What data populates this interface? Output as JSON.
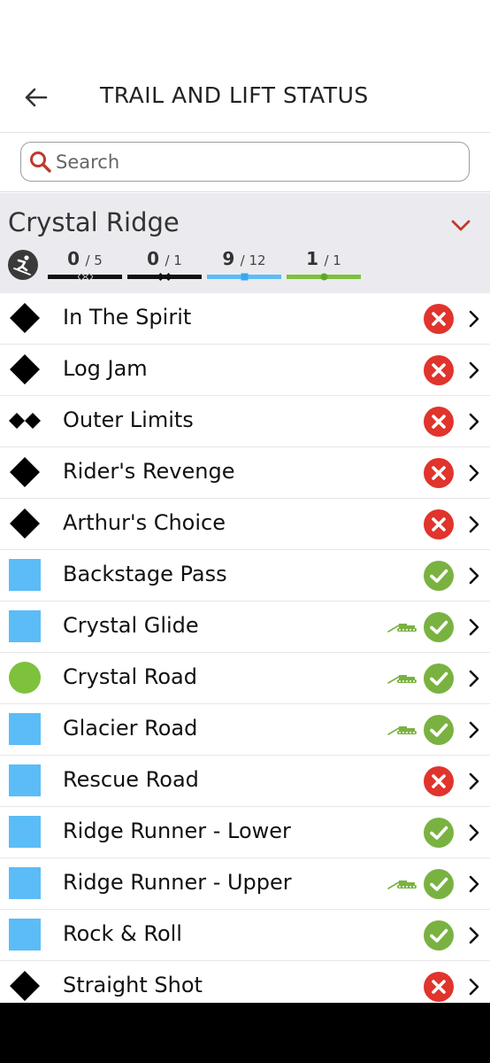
{
  "header": {
    "title": "TRAIL AND LIFT STATUS",
    "back_icon": "arrow-left-icon"
  },
  "search": {
    "placeholder": "Search",
    "icon": "search-icon"
  },
  "colors": {
    "accent_red": "#c0392b",
    "open_green": "#7ab241",
    "closed_red": "#e0342c",
    "blue_square": "#5bbcf7",
    "green_circle": "#7dc13c",
    "black_diamond": "#000000"
  },
  "area": {
    "name": "Crystal Ridge",
    "stats": [
      {
        "key": "double_black",
        "open": "0",
        "total": "/ 5",
        "color": "#111111",
        "marker": "double-diamond"
      },
      {
        "key": "black",
        "open": "0",
        "total": "/ 1",
        "color": "#111111",
        "marker": "diamond"
      },
      {
        "key": "blue",
        "open": "9",
        "total": "/ 12",
        "color": "#5bbcf7",
        "marker": "square"
      },
      {
        "key": "green",
        "open": "1",
        "total": "/ 1",
        "color": "#7dc13c",
        "marker": "circle"
      }
    ]
  },
  "trails": [
    {
      "name": "In The Spirit",
      "difficulty": "black-diamond",
      "status": "closed",
      "groomed": false
    },
    {
      "name": "Log Jam",
      "difficulty": "black-diamond",
      "status": "closed",
      "groomed": false
    },
    {
      "name": "Outer Limits",
      "difficulty": "double-black-diamond",
      "status": "closed",
      "groomed": false
    },
    {
      "name": "Rider's Revenge",
      "difficulty": "black-diamond",
      "status": "closed",
      "groomed": false
    },
    {
      "name": "Arthur's Choice",
      "difficulty": "black-diamond",
      "status": "closed",
      "groomed": false
    },
    {
      "name": "Backstage Pass",
      "difficulty": "blue-square",
      "status": "open",
      "groomed": false
    },
    {
      "name": "Crystal Glide",
      "difficulty": "blue-square",
      "status": "open",
      "groomed": true
    },
    {
      "name": "Crystal Road",
      "difficulty": "green-circle",
      "status": "open",
      "groomed": true
    },
    {
      "name": "Glacier Road",
      "difficulty": "blue-square",
      "status": "open",
      "groomed": true
    },
    {
      "name": "Rescue Road",
      "difficulty": "blue-square",
      "status": "closed",
      "groomed": false
    },
    {
      "name": "Ridge Runner - Lower",
      "difficulty": "blue-square",
      "status": "open",
      "groomed": false
    },
    {
      "name": "Ridge Runner - Upper",
      "difficulty": "blue-square",
      "status": "open",
      "groomed": true
    },
    {
      "name": "Rock & Roll",
      "difficulty": "blue-square",
      "status": "open",
      "groomed": false
    },
    {
      "name": "Straight Shot",
      "difficulty": "black-diamond",
      "status": "closed",
      "groomed": false
    }
  ]
}
